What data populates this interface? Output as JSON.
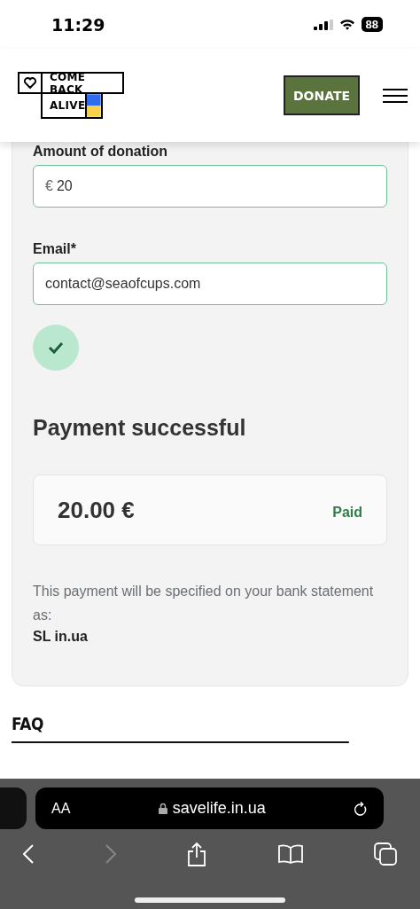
{
  "status_bar": {
    "time": "11:29",
    "battery": "88"
  },
  "header": {
    "logo_line1": "COME BACK",
    "logo_line2": "ALIVE",
    "donate_button": "DONATE"
  },
  "form": {
    "amount_label": "Amount of donation",
    "amount_currency": "€",
    "amount_value": "20",
    "email_label": "Email*",
    "email_value": "contact@seaofcups.com"
  },
  "result": {
    "title": "Payment successful",
    "amount": "20.00 €",
    "status": "Paid",
    "note": "This payment will be specified on your bank statement as:",
    "descriptor": "SL in.ua"
  },
  "faq": {
    "title": "FAQ"
  },
  "browser": {
    "text_size": "AA",
    "url": "savelife.in.ua"
  }
}
